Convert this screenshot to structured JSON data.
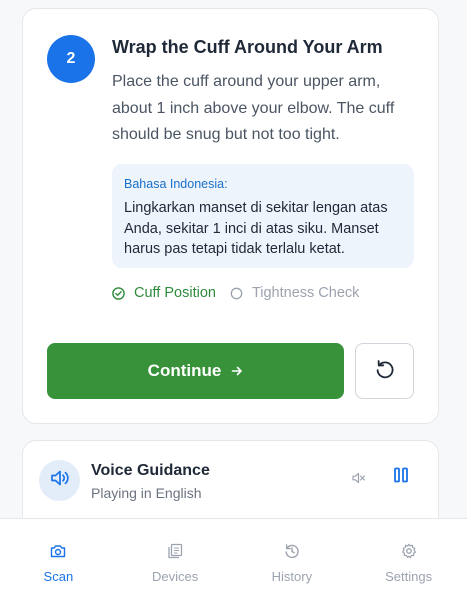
{
  "step": {
    "number": "2",
    "title": "Wrap the Cuff Around Your Arm",
    "description": "Place the cuff around your upper arm, about 1 inch above your elbow. The cuff should be snug but not too tight.",
    "translation": {
      "language": "Bahasa Indonesia:",
      "text": "Lingkarkan manset di sekitar lengan atas Anda, sekitar 1 inci di atas siku. Manset harus pas tetapi tidak terlalu ketat."
    },
    "checks": [
      {
        "label": "Cuff Position",
        "status": "done",
        "icon": "check-circle-icon"
      },
      {
        "label": "Tightness Check",
        "status": "pending",
        "icon": "empty-circle-icon"
      }
    ],
    "continue_label": "Continue",
    "continue_icon": "arrow-right-icon",
    "reset_icon": "rotate-ccw-icon"
  },
  "voice": {
    "title": "Voice Guidance",
    "status": "Playing in English",
    "icon": "speaker-icon",
    "mute_icon": "volume-mute-icon",
    "pause_icon": "pause-icon"
  },
  "nav": {
    "items": [
      {
        "label": "Scan",
        "icon": "camera-icon",
        "active": true
      },
      {
        "label": "Devices",
        "icon": "devices-icon",
        "active": false
      },
      {
        "label": "History",
        "icon": "history-icon",
        "active": false
      },
      {
        "label": "Settings",
        "icon": "gear-icon",
        "active": false
      }
    ]
  },
  "colors": {
    "primary": "#1a73e8",
    "success": "#37923a",
    "muted": "#9ca3af",
    "translation_bg": "#eef4fc"
  }
}
